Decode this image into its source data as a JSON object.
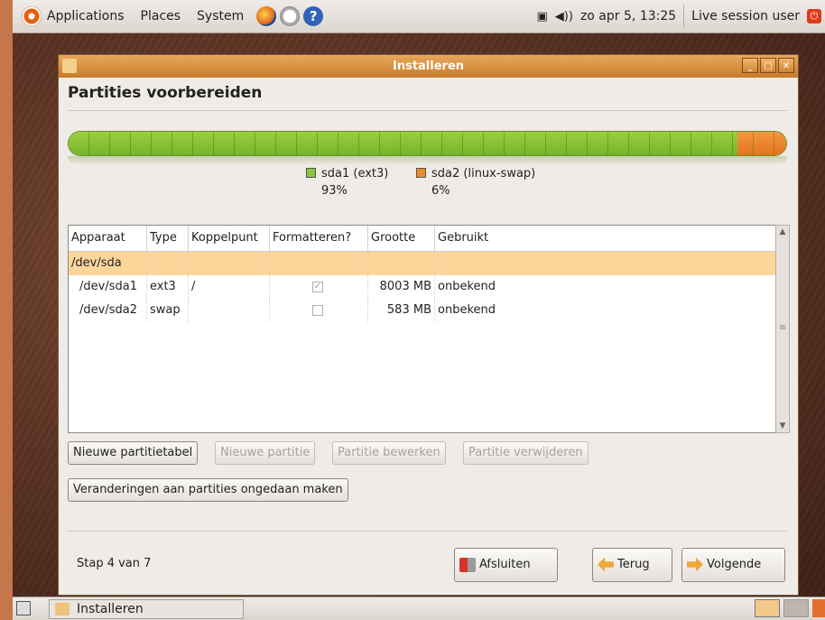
{
  "top_panel": {
    "menus": [
      "Applications",
      "Places",
      "System"
    ],
    "clock": "zo apr  5, 13:25",
    "user": "Live session user"
  },
  "window": {
    "title": "Installeren",
    "heading": "Partities voorbereiden",
    "partitions_bar": {
      "segments": [
        {
          "label": "sda1 (ext3)",
          "percent": "93%",
          "color": "#8cc63f"
        },
        {
          "label": "sda2 (linux-swap)",
          "percent": "6%",
          "color": "#ed8a2c"
        }
      ]
    },
    "table": {
      "headers": [
        "Apparaat",
        "Type",
        "Koppelpunt",
        "Formatteren?",
        "Grootte",
        "Gebruikt"
      ],
      "rows": [
        {
          "device": "/dev/sda",
          "type": "",
          "mount": "",
          "format": null,
          "size": "",
          "used": ""
        },
        {
          "device": "/dev/sda1",
          "type": "ext3",
          "mount": "/",
          "format": true,
          "size": "8003 MB",
          "used": "onbekend"
        },
        {
          "device": "/dev/sda2",
          "type": "swap",
          "mount": "",
          "format": false,
          "size": "583 MB",
          "used": "onbekend"
        }
      ]
    },
    "buttons": {
      "new_table": "Nieuwe partitietabel",
      "new_partition": "Nieuwe partitie",
      "edit_partition": "Partitie bewerken",
      "delete_partition": "Partitie verwijderen",
      "undo": "Veranderingen aan partities ongedaan maken",
      "quit": "Afsluiten",
      "back": "Terug",
      "next": "Volgende"
    },
    "step": "Stap 4 van 7"
  },
  "bottom_panel": {
    "task": "Installeren"
  },
  "colors": {
    "accent": "#e5731c",
    "selection": "#fbd59a",
    "titlebar": "#d98b3a"
  }
}
